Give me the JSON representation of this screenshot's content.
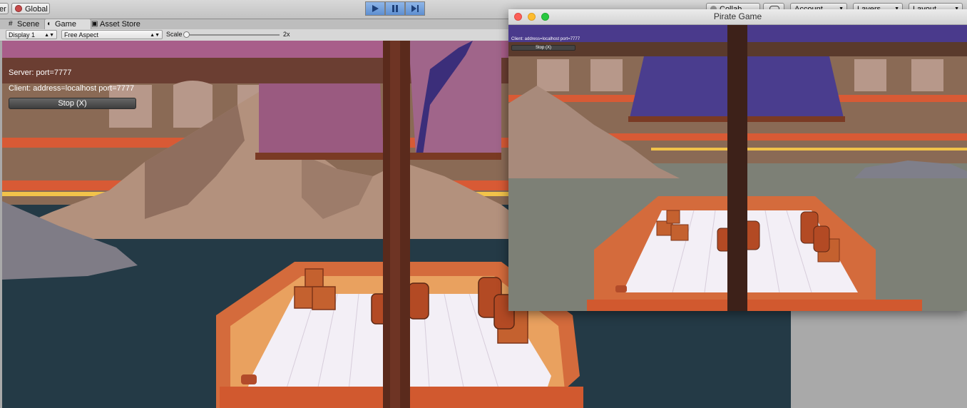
{
  "toolbar": {
    "pivot_label": "er",
    "global_label": "Global",
    "collab_label": "Collab",
    "account_label": "Account",
    "layers_label": "Layers",
    "layout_label": "Layout",
    "play_icon": "play-icon",
    "pause_icon": "pause-icon",
    "step_icon": "step-icon"
  },
  "tabs": [
    {
      "label": "Scene",
      "icon": "scene-grid-icon"
    },
    {
      "label": "Game",
      "icon": "game-pacman-icon",
      "active": true
    },
    {
      "label": "Asset Store",
      "icon": "store-bag-icon"
    }
  ],
  "game_bar": {
    "display": "Display 1",
    "aspect": "Free Aspect",
    "scale_label": "Scale",
    "scale_value": "2x"
  },
  "editor_view": {
    "server_status": "Server: port=7777",
    "client_status": "Client: address=localhost port=7777",
    "stop_button": "Stop (X)"
  },
  "client_window": {
    "title": "Pirate Game",
    "client_status": "Client: address=localhost port=7777",
    "stop_button": "Stop (X)"
  },
  "colors": {
    "play_active": "#5e8fd1",
    "sky_purple": "#a85e8a",
    "water": "#243a46",
    "deck": "#f3eff6",
    "hull": "#d46b3c",
    "mast": "#5a2a1c"
  }
}
